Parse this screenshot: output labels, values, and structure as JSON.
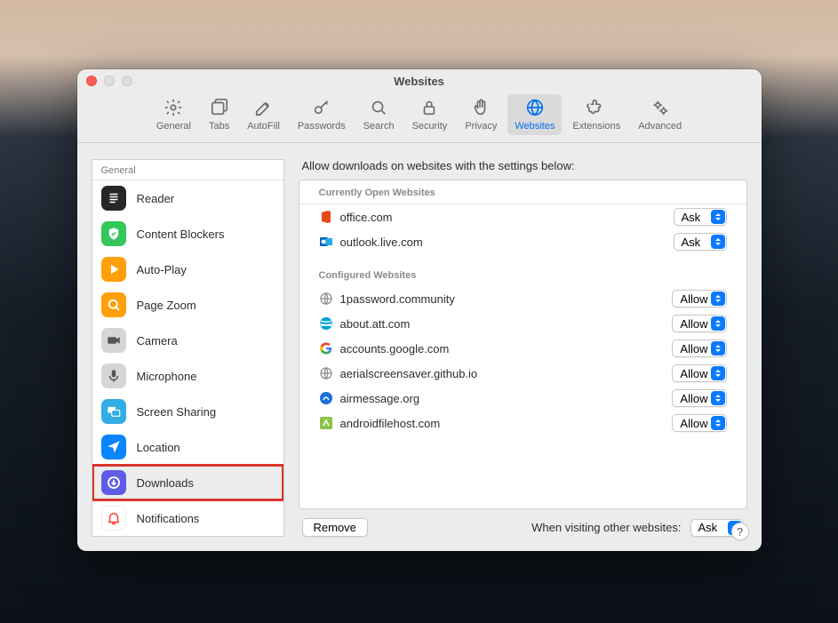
{
  "window": {
    "title": "Websites"
  },
  "toolbar": {
    "general": "General",
    "tabs": "Tabs",
    "autofill": "AutoFill",
    "passwords": "Passwords",
    "search": "Search",
    "security": "Security",
    "privacy": "Privacy",
    "websites": "Websites",
    "extensions": "Extensions",
    "advanced": "Advanced"
  },
  "sidebar": {
    "header": "General",
    "items": [
      {
        "name": "reader",
        "label": "Reader"
      },
      {
        "name": "content-blockers",
        "label": "Content Blockers"
      },
      {
        "name": "auto-play",
        "label": "Auto-Play"
      },
      {
        "name": "page-zoom",
        "label": "Page Zoom"
      },
      {
        "name": "camera",
        "label": "Camera"
      },
      {
        "name": "microphone",
        "label": "Microphone"
      },
      {
        "name": "screen-sharing",
        "label": "Screen Sharing"
      },
      {
        "name": "location",
        "label": "Location"
      },
      {
        "name": "downloads",
        "label": "Downloads"
      },
      {
        "name": "notifications",
        "label": "Notifications"
      }
    ]
  },
  "detail": {
    "header": "Allow downloads on websites with the settings below:",
    "open_header": "Currently Open Websites",
    "configured_header": "Configured Websites",
    "open": [
      {
        "label": "office.com",
        "setting": "Ask",
        "favicon": "office"
      },
      {
        "label": "outlook.live.com",
        "setting": "Ask",
        "favicon": "outlook"
      }
    ],
    "configured": [
      {
        "label": "1password.community",
        "setting": "Allow",
        "favicon": "globe"
      },
      {
        "label": "about.att.com",
        "setting": "Allow",
        "favicon": "att"
      },
      {
        "label": "accounts.google.com",
        "setting": "Allow",
        "favicon": "google"
      },
      {
        "label": "aerialscreensaver.github.io",
        "setting": "Allow",
        "favicon": "globe"
      },
      {
        "label": "airmessage.org",
        "setting": "Allow",
        "favicon": "air"
      },
      {
        "label": "androidfilehost.com",
        "setting": "Allow",
        "favicon": "afh"
      }
    ],
    "remove_label": "Remove",
    "default_label": "When visiting other websites:",
    "default_value": "Ask"
  },
  "help": "?"
}
